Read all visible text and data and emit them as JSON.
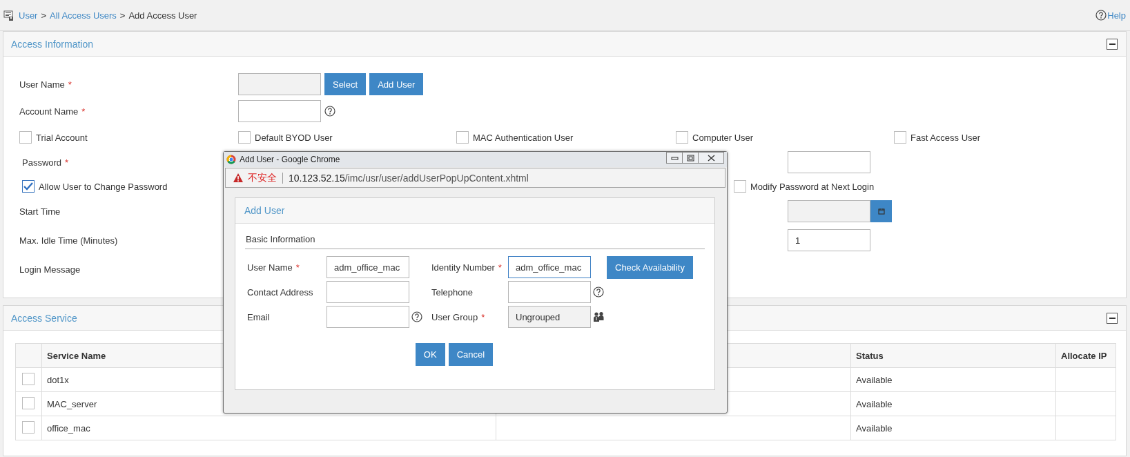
{
  "breadcrumb": {
    "items": [
      {
        "kind": "link",
        "label": "User"
      },
      {
        "kind": "separator",
        "label": ">"
      },
      {
        "kind": "link",
        "label": "All Access Users"
      },
      {
        "kind": "separator",
        "label": ">"
      },
      {
        "kind": "current",
        "label": "Add Access User"
      }
    ],
    "help": "Help"
  },
  "access_information": {
    "title": "Access Information",
    "user_name": {
      "label": "User Name",
      "required_mark": "*",
      "disabled": true,
      "buttons": [
        "Select",
        "Add User"
      ]
    },
    "account_name": {
      "label": "Account Name",
      "required_mark": "*",
      "disabled": false
    },
    "options": [
      {
        "label": "Trial Account",
        "checked": false
      },
      {
        "label": "Default BYOD User",
        "checked": false
      },
      {
        "label": "MAC Authentication User",
        "checked": false
      },
      {
        "label": "Computer User",
        "checked": false
      },
      {
        "label": "Fast Access User",
        "checked": false
      }
    ],
    "password": {
      "label": "Password",
      "required_mark": "*"
    },
    "allow_change_password": {
      "label": "Allow User to Change Password",
      "checked": true
    },
    "modify_password_next_login": {
      "label": "Modify Password at Next Login",
      "checked": false
    },
    "start_time": {
      "label": "Start Time",
      "disabled": true
    },
    "max_idle_time": {
      "label": "Max. Idle Time (Minutes)",
      "value": "1"
    },
    "login_message": {
      "label": "Login Message"
    }
  },
  "access_service": {
    "title": "Access Service",
    "columns": [
      {
        "kind": "checkbox"
      },
      {
        "kind": "text",
        "label": "Service Name"
      },
      {
        "kind": "text"
      },
      {
        "kind": "text",
        "label": "Status"
      },
      {
        "kind": "text",
        "label": "Allocate IP"
      }
    ],
    "rows": [
      {
        "checked": false,
        "service_name": "dot1x",
        "status": "Available"
      },
      {
        "checked": false,
        "service_name": "MAC_server",
        "status": "Available"
      },
      {
        "checked": false,
        "service_name": "office_mac",
        "status": "Available"
      }
    ]
  },
  "popup": {
    "window_title": "Add User - Google Chrome",
    "security_label": "不安全",
    "url_host": "10.123.52.15",
    "url_path": "/imc/usr/user/addUserPopUpContent.xhtml",
    "panel_title": "Add User",
    "section_title": "Basic Information",
    "fields": [
      {
        "label": "User Name",
        "required_mark": "*",
        "value": "adm_office_mac",
        "disabled": false,
        "focused": false,
        "kind": "plain"
      },
      {
        "label": "Identity Number",
        "required_mark": "*",
        "value": "adm_office_mac",
        "disabled": false,
        "focused": true,
        "kind": "plain"
      },
      {
        "label": "Contact Address",
        "disabled": false,
        "focused": false,
        "kind": "plain"
      },
      {
        "label": "Telephone",
        "disabled": false,
        "focused": false,
        "kind": "help"
      },
      {
        "label": "Email",
        "disabled": false,
        "focused": false,
        "kind": "help"
      },
      {
        "label": "User Group",
        "required_mark": "*",
        "value": "Ungrouped",
        "disabled": true,
        "focused": false,
        "kind": "group"
      }
    ],
    "check_button": "Check Availability",
    "buttons": [
      "OK",
      "Cancel"
    ]
  }
}
